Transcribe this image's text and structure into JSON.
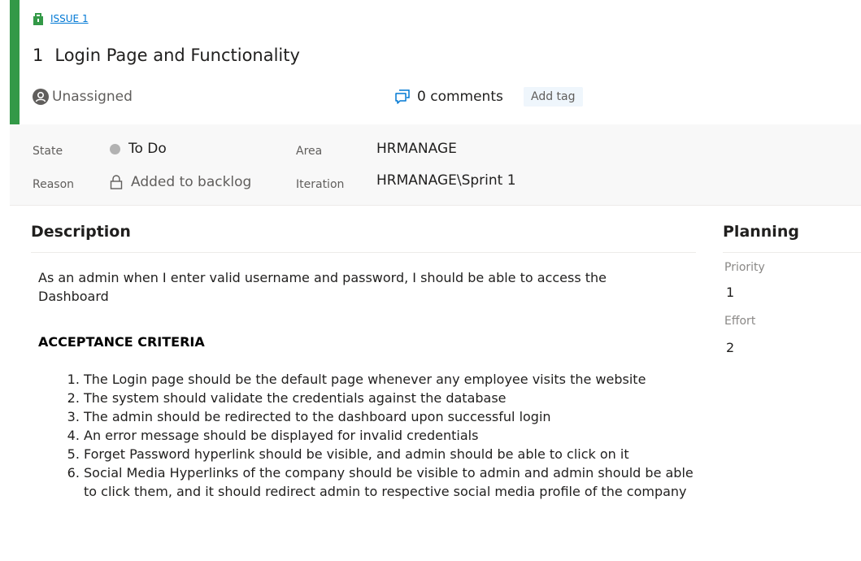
{
  "work_item": {
    "type_label": "ISSUE 1",
    "id": "1",
    "title": "Login Page and Functionality",
    "assignee": "Unassigned",
    "comments": "0 comments",
    "add_tag": "Add tag",
    "accent_color": "#339947"
  },
  "fields": {
    "state_label": "State",
    "state_value": "To Do",
    "reason_label": "Reason",
    "reason_value": "Added to backlog",
    "area_label": "Area",
    "area_value": "HRMANAGE",
    "iteration_label": "Iteration",
    "iteration_value": "HRMANAGE\\Sprint 1"
  },
  "description": {
    "title": "Description",
    "text": "As an admin when I enter valid username and password, I should be able to access the Dashboard",
    "criteria_heading": "ACCEPTANCE CRITERIA",
    "criteria": [
      "The Login page should be the default page whenever any employee visits the website",
      "The system should validate the credentials against the database",
      "The admin should be redirected to the dashboard upon successful login",
      "An error message should be displayed for invalid credentials",
      "Forget Password hyperlink should be visible, and admin should be able to click on it",
      "Social Media Hyperlinks of the company should be visible to admin and admin should be able to click them, and it should redirect admin to respective social media profile of the company"
    ]
  },
  "planning": {
    "title": "Planning",
    "priority_label": "Priority",
    "priority_value": "1",
    "effort_label": "Effort",
    "effort_value": "2"
  },
  "icons": {
    "type": "issue-icon",
    "assignee": "avatar-icon",
    "comments": "comment-icon",
    "reason": "lock-icon"
  }
}
